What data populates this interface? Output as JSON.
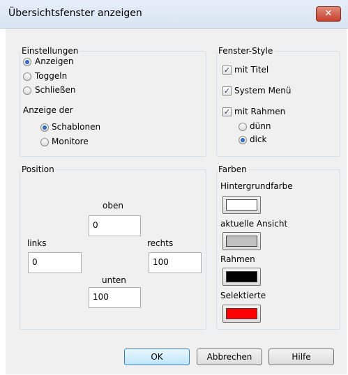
{
  "window": {
    "title": "Übersichtsfenster anzeigen",
    "close_glyph": "✕"
  },
  "einstellungen": {
    "legend": "Einstellungen",
    "options": [
      {
        "label": "Anzeigen",
        "selected": true
      },
      {
        "label": "Toggeln",
        "selected": false
      },
      {
        "label": "Schließen",
        "selected": false
      }
    ],
    "anzeige_label": "Anzeige der",
    "anzeige_options": [
      {
        "label": "Schablonen",
        "selected": true
      },
      {
        "label": "Monitore",
        "selected": false
      }
    ]
  },
  "fenster_style": {
    "legend": "Fenster-Style",
    "checks": [
      {
        "label": "mit Titel",
        "checked": true
      },
      {
        "label": "System Menü",
        "checked": true
      },
      {
        "label": "mit Rahmen",
        "checked": true
      }
    ],
    "rahmen_options": [
      {
        "label": "dünn",
        "selected": false
      },
      {
        "label": "dick",
        "selected": true
      }
    ],
    "check_glyph": "✓"
  },
  "position": {
    "legend": "Position",
    "oben_label": "oben",
    "oben_value": "0",
    "links_label": "links",
    "links_value": "0",
    "rechts_label": "rechts",
    "rechts_value": "100",
    "unten_label": "unten",
    "unten_value": "100"
  },
  "farben": {
    "legend": "Farben",
    "items": [
      {
        "label": "Hintergrundfarbe",
        "color": "#ffffff"
      },
      {
        "label": "aktuelle Ansicht",
        "color": "#c0c0c0"
      },
      {
        "label": "Rahmen",
        "color": "#000000"
      },
      {
        "label": "Selektierte",
        "color": "#ff0000"
      }
    ]
  },
  "buttons": {
    "ok": "OK",
    "cancel": "Abbrechen",
    "help": "Hilfe"
  }
}
